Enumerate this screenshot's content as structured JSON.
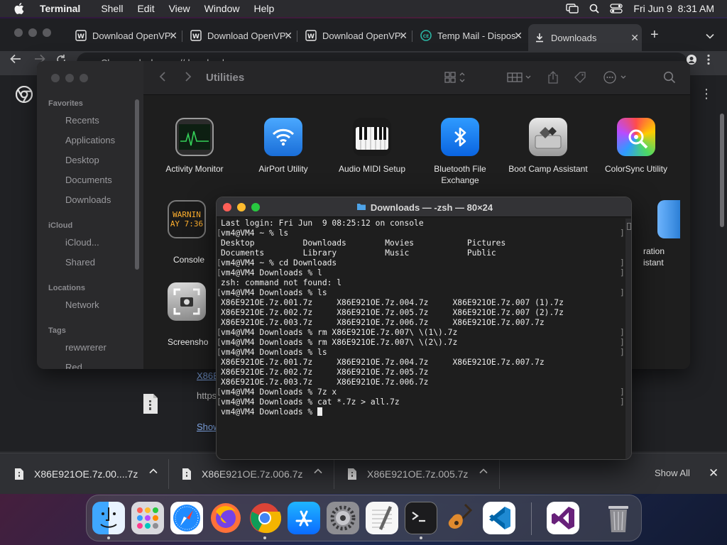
{
  "menubar": {
    "app_name": "Terminal",
    "menus": [
      "Shell",
      "Edit",
      "View",
      "Window",
      "Help"
    ],
    "datetime": "Fri Jun 9  8:31 AM"
  },
  "chrome": {
    "tabs": [
      {
        "title": "Download OpenVPN",
        "icon": "openvpn-icon",
        "active": false
      },
      {
        "title": "Download OpenVPN",
        "icon": "openvpn-icon",
        "active": false
      },
      {
        "title": "Download OpenVPN",
        "icon": "openvpn-icon",
        "active": false
      },
      {
        "title": "Temp Mail - Disposable",
        "icon": "tempmail-icon",
        "active": false
      },
      {
        "title": "Downloads",
        "icon": "download-icon",
        "active": true
      }
    ],
    "omnibox": "Chrome  |  chrome://downloads",
    "download_card": {
      "filename": "X86E",
      "url": "https",
      "show": "Show"
    }
  },
  "shelf": {
    "items": [
      {
        "name": "X86E921OE.7z.00....7z"
      },
      {
        "name": "X86E921OE.7z.006.7z"
      },
      {
        "name": "X86E921OE.7z.005.7z"
      }
    ],
    "show_all": "Show All"
  },
  "finder": {
    "title": "Utilities",
    "sidebar": {
      "favorites_label": "Favorites",
      "favorites": [
        "Recents",
        "Applications",
        "Desktop",
        "Documents",
        "Downloads"
      ],
      "icloud_label": "iCloud",
      "icloud": [
        "iCloud...",
        "Shared"
      ],
      "locations_label": "Locations",
      "locations": [
        "Network"
      ],
      "tags_label": "Tags",
      "tags": [
        "rewwrerer",
        "Red"
      ]
    },
    "apps": [
      {
        "name": "Activity Monitor"
      },
      {
        "name": "AirPort Utility"
      },
      {
        "name": "Audio MIDI Setup"
      },
      {
        "name": "Bluetooth File Exchange"
      },
      {
        "name": "Boot Camp Assistant"
      },
      {
        "name": "ColorSync Utility"
      },
      {
        "name": "Console",
        "icon_text_1": "WARNIN",
        "icon_text_2": "AY 7:36"
      },
      {
        "name": "ration\nistant"
      },
      {
        "name": "Screensho"
      }
    ]
  },
  "terminal": {
    "title": "Downloads — -zsh — 80×24",
    "lines": [
      "Last login: Fri Jun  9 08:25:12 on console",
      "vm4@VM4 ~ % ls",
      "Desktop          Downloads        Movies           Pictures",
      "Documents        Library          Music            Public",
      "vm4@VM4 ~ % cd Downloads",
      "vm4@VM4 Downloads % l",
      "zsh: command not found: l",
      "vm4@VM4 Downloads % ls",
      "X86E921OE.7z.001.7z     X86E921OE.7z.004.7z     X86E921OE.7z.007 (1).7z",
      "X86E921OE.7z.002.7z     X86E921OE.7z.005.7z     X86E921OE.7z.007 (2).7z",
      "X86E921OE.7z.003.7z     X86E921OE.7z.006.7z     X86E921OE.7z.007.7z",
      "vm4@VM4 Downloads % rm X86E921OE.7z.007\\ \\(1\\).7z",
      "vm4@VM4 Downloads % rm X86E921OE.7z.007\\ \\(2\\).7z",
      "vm4@VM4 Downloads % ls",
      "X86E921OE.7z.001.7z     X86E921OE.7z.004.7z     X86E921OE.7z.007.7z",
      "X86E921OE.7z.002.7z     X86E921OE.7z.005.7z",
      "X86E921OE.7z.003.7z     X86E921OE.7z.006.7z",
      "vm4@VM4 Downloads % 7z x",
      "vm4@VM4 Downloads % cat *.7z > all.7z",
      "vm4@VM4 Downloads % "
    ],
    "prompt_lines": [
      1,
      4,
      5,
      7,
      11,
      12,
      13,
      17,
      18
    ]
  },
  "dock": {
    "apps": [
      "finder-icon",
      "launchpad-icon",
      "safari-icon",
      "firefox-icon",
      "chrome-icon",
      "app-store-icon",
      "system-settings-icon",
      "textedit-icon",
      "terminal-icon",
      "garageband-icon",
      "vscode-icon",
      "visual-studio-icon",
      "trash-icon"
    ]
  },
  "colors": {
    "terminal_bg": "#1e1e1e",
    "red": "#ff5f57",
    "yellow": "#febc2e",
    "green": "#28c840",
    "link": "#8ab4f8"
  }
}
